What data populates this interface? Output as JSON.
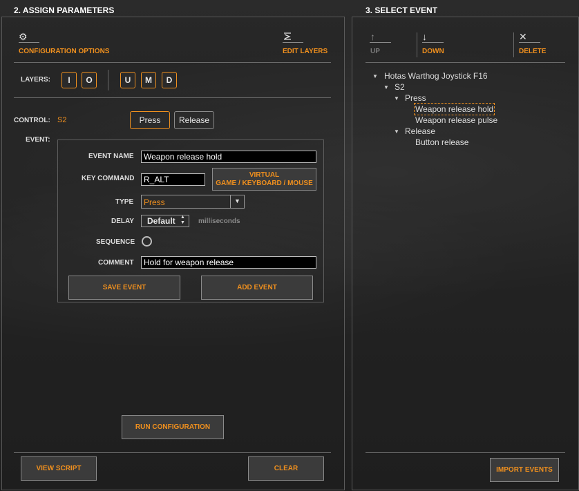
{
  "left_panel": {
    "title": "2. ASSIGN PARAMETERS",
    "config_options_label": "CONFIGURATION OPTIONS",
    "edit_layers_label": "EDIT LAYERS",
    "layers_label": "LAYERS:",
    "layers_group1": [
      "I",
      "O"
    ],
    "layers_group2": [
      "U",
      "M",
      "D"
    ],
    "control_label": "CONTROL:",
    "control_value": "S2",
    "press_label": "Press",
    "release_label": "Release",
    "event_label": "EVENT:",
    "event": {
      "event_name_label": "EVENT NAME",
      "event_name_value": "Weapon release hold",
      "key_command_label": "KEY COMMAND",
      "key_command_value": "R_ALT",
      "virtual_button_line1": "VIRTUAL",
      "virtual_button_line2": "GAME / KEYBOARD / MOUSE",
      "type_label": "TYPE",
      "type_value": "Press",
      "delay_label": "DELAY",
      "delay_value": "Default",
      "delay_unit": "milliseconds",
      "sequence_label": "SEQUENCE",
      "comment_label": "COMMENT",
      "comment_value": "Hold for weapon release",
      "save_event_label": "SAVE EVENT",
      "add_event_label": "ADD EVENT"
    },
    "run_configuration_label": "RUN CONFIGURATION",
    "view_script_label": "VIEW SCRIPT",
    "clear_label": "CLEAR"
  },
  "right_panel": {
    "title": "3. SELECT EVENT",
    "up_label": "UP",
    "down_label": "DOWN",
    "delete_label": "DELETE",
    "tree": {
      "root": "Hotas Warthog Joystick F16",
      "control": "S2",
      "press_group": "Press",
      "press_items": [
        "Weapon release hold",
        "Weapon release pulse"
      ],
      "release_group": "Release",
      "release_items": [
        "Button release"
      ]
    },
    "import_events_label": "IMPORT EVENTS"
  },
  "icons": {
    "config": "gear-icon",
    "edit_layers": "layers-edit-icon",
    "up": "arrow-up-icon",
    "down": "arrow-down-icon",
    "delete": "close-icon"
  },
  "colors": {
    "accent": "#f0901e",
    "background": "#262626"
  }
}
